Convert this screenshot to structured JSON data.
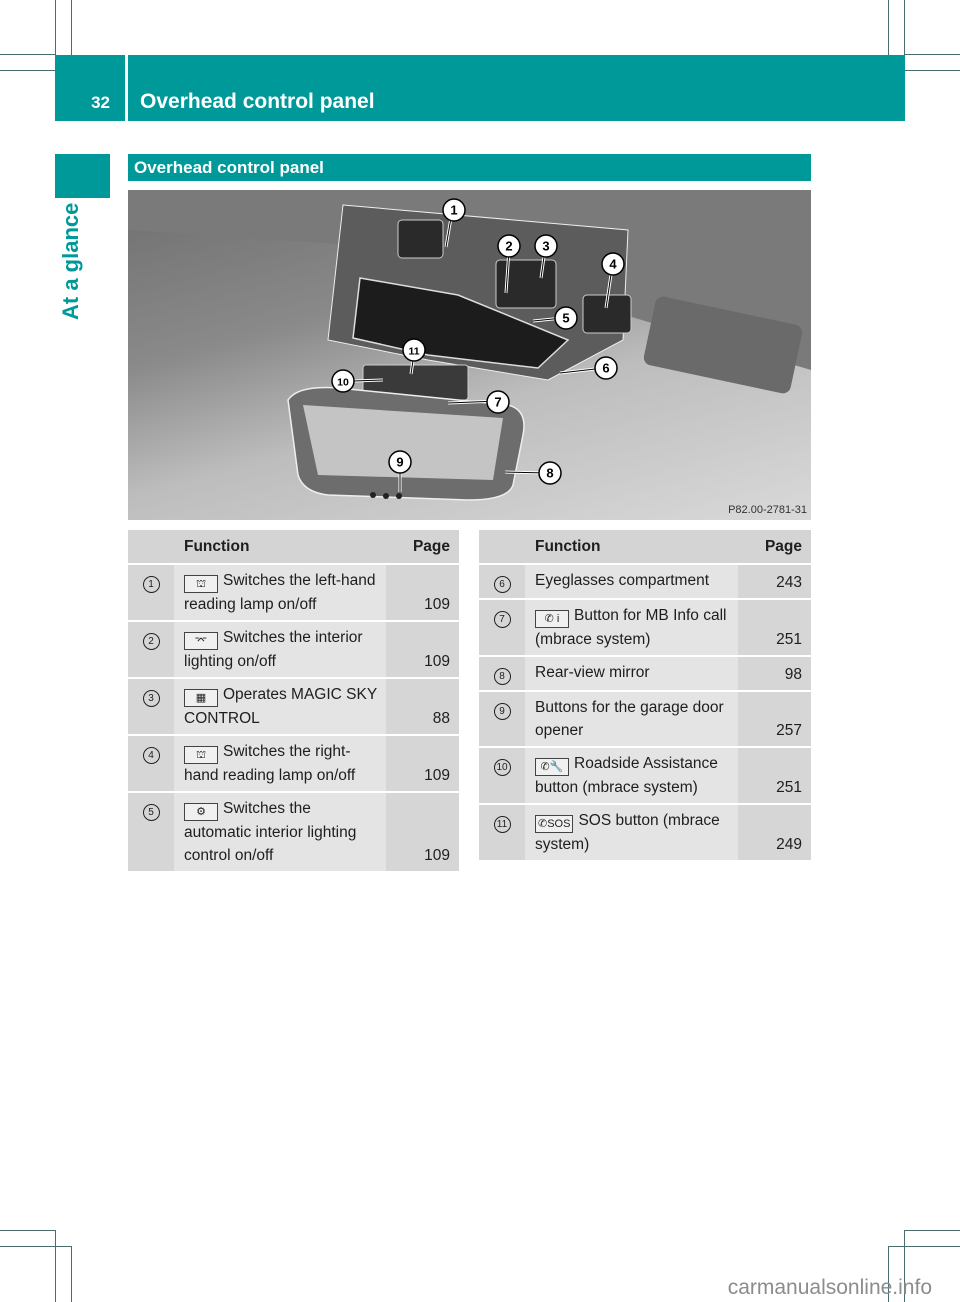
{
  "header": {
    "page_number": "32",
    "title": "Overhead control panel"
  },
  "side_tab": {
    "label": "At a glance"
  },
  "section": {
    "title": "Overhead control panel"
  },
  "figure": {
    "code": "P82.00-2781-31",
    "callouts": [
      "1",
      "2",
      "3",
      "4",
      "5",
      "6",
      "7",
      "8",
      "9",
      "10",
      "11"
    ]
  },
  "tables": {
    "left": {
      "headers": {
        "num": "",
        "function": "Function",
        "page": "Page"
      },
      "rows": [
        {
          "num": "1",
          "icon": "reading-lamp-icon",
          "icon_glyph": "⛫",
          "function": "Switches the left-hand reading lamp on/off",
          "page": "109"
        },
        {
          "num": "2",
          "icon": "interior-light-icon",
          "icon_glyph": "⌤",
          "function": "Switches the interior lighting on/off",
          "page": "109"
        },
        {
          "num": "3",
          "icon": "magic-sky-icon",
          "icon_glyph": "▦",
          "function": "Operates MAGIC SKY CONTROL",
          "page": "88"
        },
        {
          "num": "4",
          "icon": "reading-lamp-icon",
          "icon_glyph": "⛫",
          "function": "Switches the right-hand reading lamp on/off",
          "page": "109"
        },
        {
          "num": "5",
          "icon": "auto-light-off-icon",
          "icon_glyph": "⚙",
          "function": "Switches the automatic interior lighting control on/off",
          "page": "109"
        }
      ]
    },
    "right": {
      "headers": {
        "num": "",
        "function": "Function",
        "page": "Page"
      },
      "rows": [
        {
          "num": "6",
          "icon": "",
          "icon_glyph": "",
          "function": "Eyeglasses compartment",
          "page": "243"
        },
        {
          "num": "7",
          "icon": "phone-info-icon",
          "icon_glyph": "✆ i",
          "function": "Button for MB Info call (mbrace system)",
          "page": "251"
        },
        {
          "num": "8",
          "icon": "",
          "icon_glyph": "",
          "function": "Rear-view mirror",
          "page": "98"
        },
        {
          "num": "9",
          "icon": "",
          "icon_glyph": "",
          "function": "Buttons for the garage door opener",
          "page": "257"
        },
        {
          "num": "10",
          "icon": "phone-wrench-icon",
          "icon_glyph": "✆🔧",
          "function": "Roadside Assistance button (mbrace system)",
          "page": "251"
        },
        {
          "num": "11",
          "icon": "phone-sos-icon",
          "icon_glyph": "✆SOS",
          "function": "SOS button (mbrace system)",
          "page": "249"
        }
      ]
    }
  },
  "watermark": "carmanualsonline.info",
  "colors": {
    "accent": "#009999",
    "cell_dark": "#d6d6d6",
    "cell_light": "#e4e4e4"
  }
}
